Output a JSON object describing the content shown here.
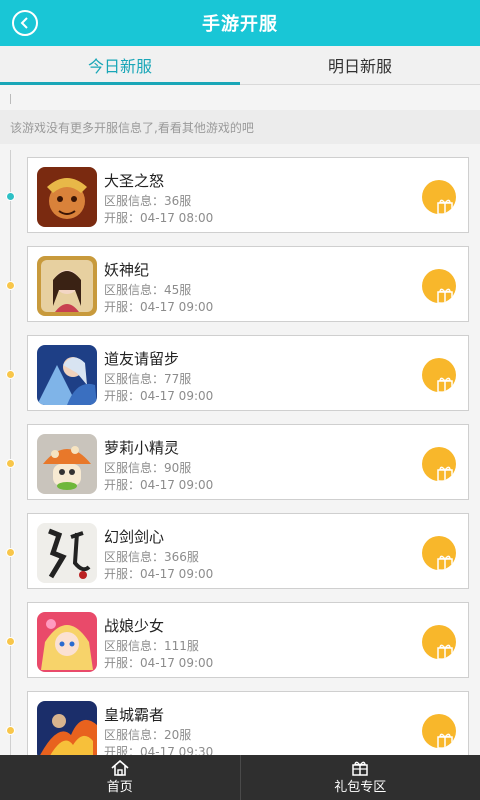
{
  "header": {
    "title": "手游开服"
  },
  "tabs": [
    {
      "label": "今日新服",
      "active": true
    },
    {
      "label": "明日新服",
      "active": false
    }
  ],
  "notice": "该游戏没有更多开服信息了,看看其他游戏的吧",
  "games": [
    {
      "name": "大圣之怒",
      "server": "区服信息：36服",
      "time": "开服：04-17 08:00",
      "icon": "monkey-king-icon"
    },
    {
      "name": "妖神纪",
      "server": "区服信息：45服",
      "time": "开服：04-17 09:00",
      "icon": "goddess-icon"
    },
    {
      "name": "道友请留步",
      "server": "区服信息：77服",
      "time": "开服：04-17 09:00",
      "icon": "warrior-icon"
    },
    {
      "name": "萝莉小精灵",
      "server": "区服信息：90服",
      "time": "开服：04-17 09:00",
      "icon": "mushroom-icon"
    },
    {
      "name": "幻剑剑心",
      "server": "区服信息：366服",
      "time": "开服：04-17 09:00",
      "icon": "sword-calligraphy-icon"
    },
    {
      "name": "战娘少女",
      "server": "区服信息：111服",
      "time": "开服：04-17 09:00",
      "icon": "anime-girl-icon"
    },
    {
      "name": "皇城霸者",
      "server": "区服信息：20服",
      "time": "开服：04-17 09:30",
      "icon": "fire-warrior-icon"
    }
  ],
  "bottom_nav": [
    {
      "label": "首页",
      "icon": "home-icon"
    },
    {
      "label": "礼包专区",
      "icon": "gift-icon"
    }
  ],
  "colors": {
    "accent": "#19c6d6",
    "tab_active": "#19a6b7",
    "gift": "#f8b72b",
    "nav_bg": "#2f2f2f"
  }
}
